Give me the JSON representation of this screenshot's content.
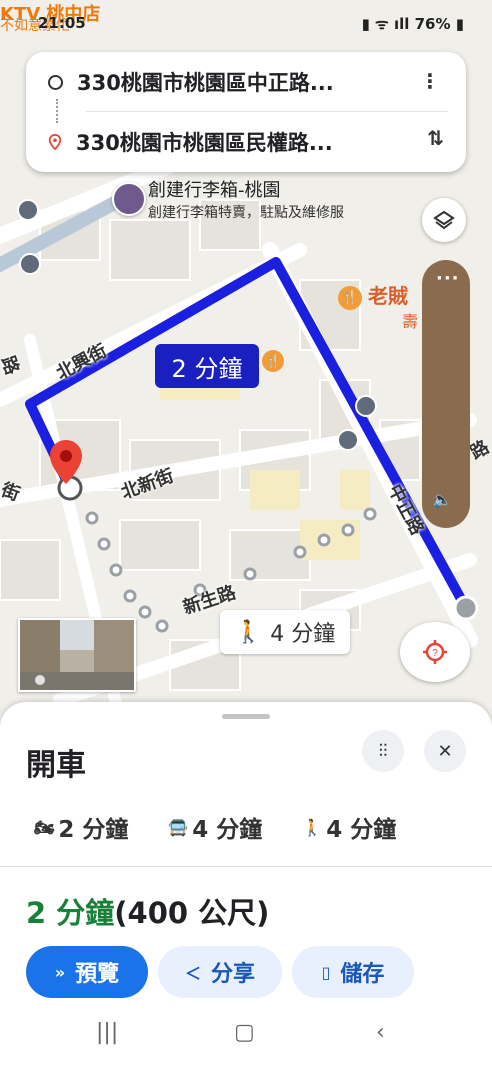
{
  "status_bar": {
    "time": "21:05",
    "battery": "76%",
    "top_overlay_place": "KTV 桃中店",
    "top_overlay_sub": "不如意繁忙"
  },
  "route_card": {
    "origin": "330桃園市桃園區中正路...",
    "destination": "330桃園市桃園區民權路..."
  },
  "map": {
    "place_name": "創建行李箱-桃園",
    "place_subtitle": "創建行李箱特賣，駐點及維修服",
    "poi_right": "老賊",
    "poi_right_sub": "壽",
    "route_time": "2 分鐘",
    "walk_time": "4 分鐘",
    "streets": {
      "beixing": "北興街",
      "beixin": "北新街",
      "xinsheng": "新生路",
      "zhongzheng": "中正路",
      "left_edge": "街",
      "left_edge2": "路",
      "right_edge": "路"
    }
  },
  "sheet": {
    "title": "開車",
    "modes": [
      {
        "icon": "motorcycle-icon",
        "label": "2 分鐘"
      },
      {
        "icon": "transit-icon",
        "label": "4 分鐘"
      },
      {
        "icon": "walk-icon",
        "label": "4 分鐘"
      }
    ],
    "summary_time": "2 分鐘",
    "summary_distance": "(400 公尺)",
    "buttons": {
      "preview": "預覽",
      "share": "分享",
      "save": "儲存"
    }
  },
  "colors": {
    "route_blue": "#1a1fe0",
    "accent_blue": "#1a73e8",
    "time_green": "#188038",
    "pin_red": "#ea4335"
  }
}
